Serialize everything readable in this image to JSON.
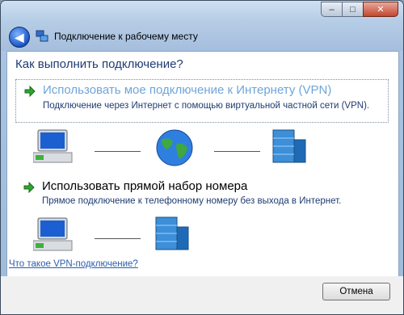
{
  "window": {
    "title": "Подключение к рабочему месту",
    "controls": {
      "minimize": "–",
      "maximize": "□",
      "close": "✕"
    }
  },
  "question": "Как выполнить подключение?",
  "options": [
    {
      "title": "Использовать мое подключение к Интернету (VPN)",
      "description": "Подключение через Интернет с помощью виртуальной частной сети (VPN)."
    },
    {
      "title": "Использовать прямой набор номера",
      "description": "Прямое подключение к телефонному номеру без выхода в Интернет."
    }
  ],
  "link": "Что такое VPN-подключение?",
  "buttons": {
    "cancel": "Отмена"
  },
  "icons": [
    "back-arrow-icon",
    "network-place-icon",
    "green-arrow-icon",
    "computer-icon",
    "globe-icon",
    "building-icon"
  ]
}
